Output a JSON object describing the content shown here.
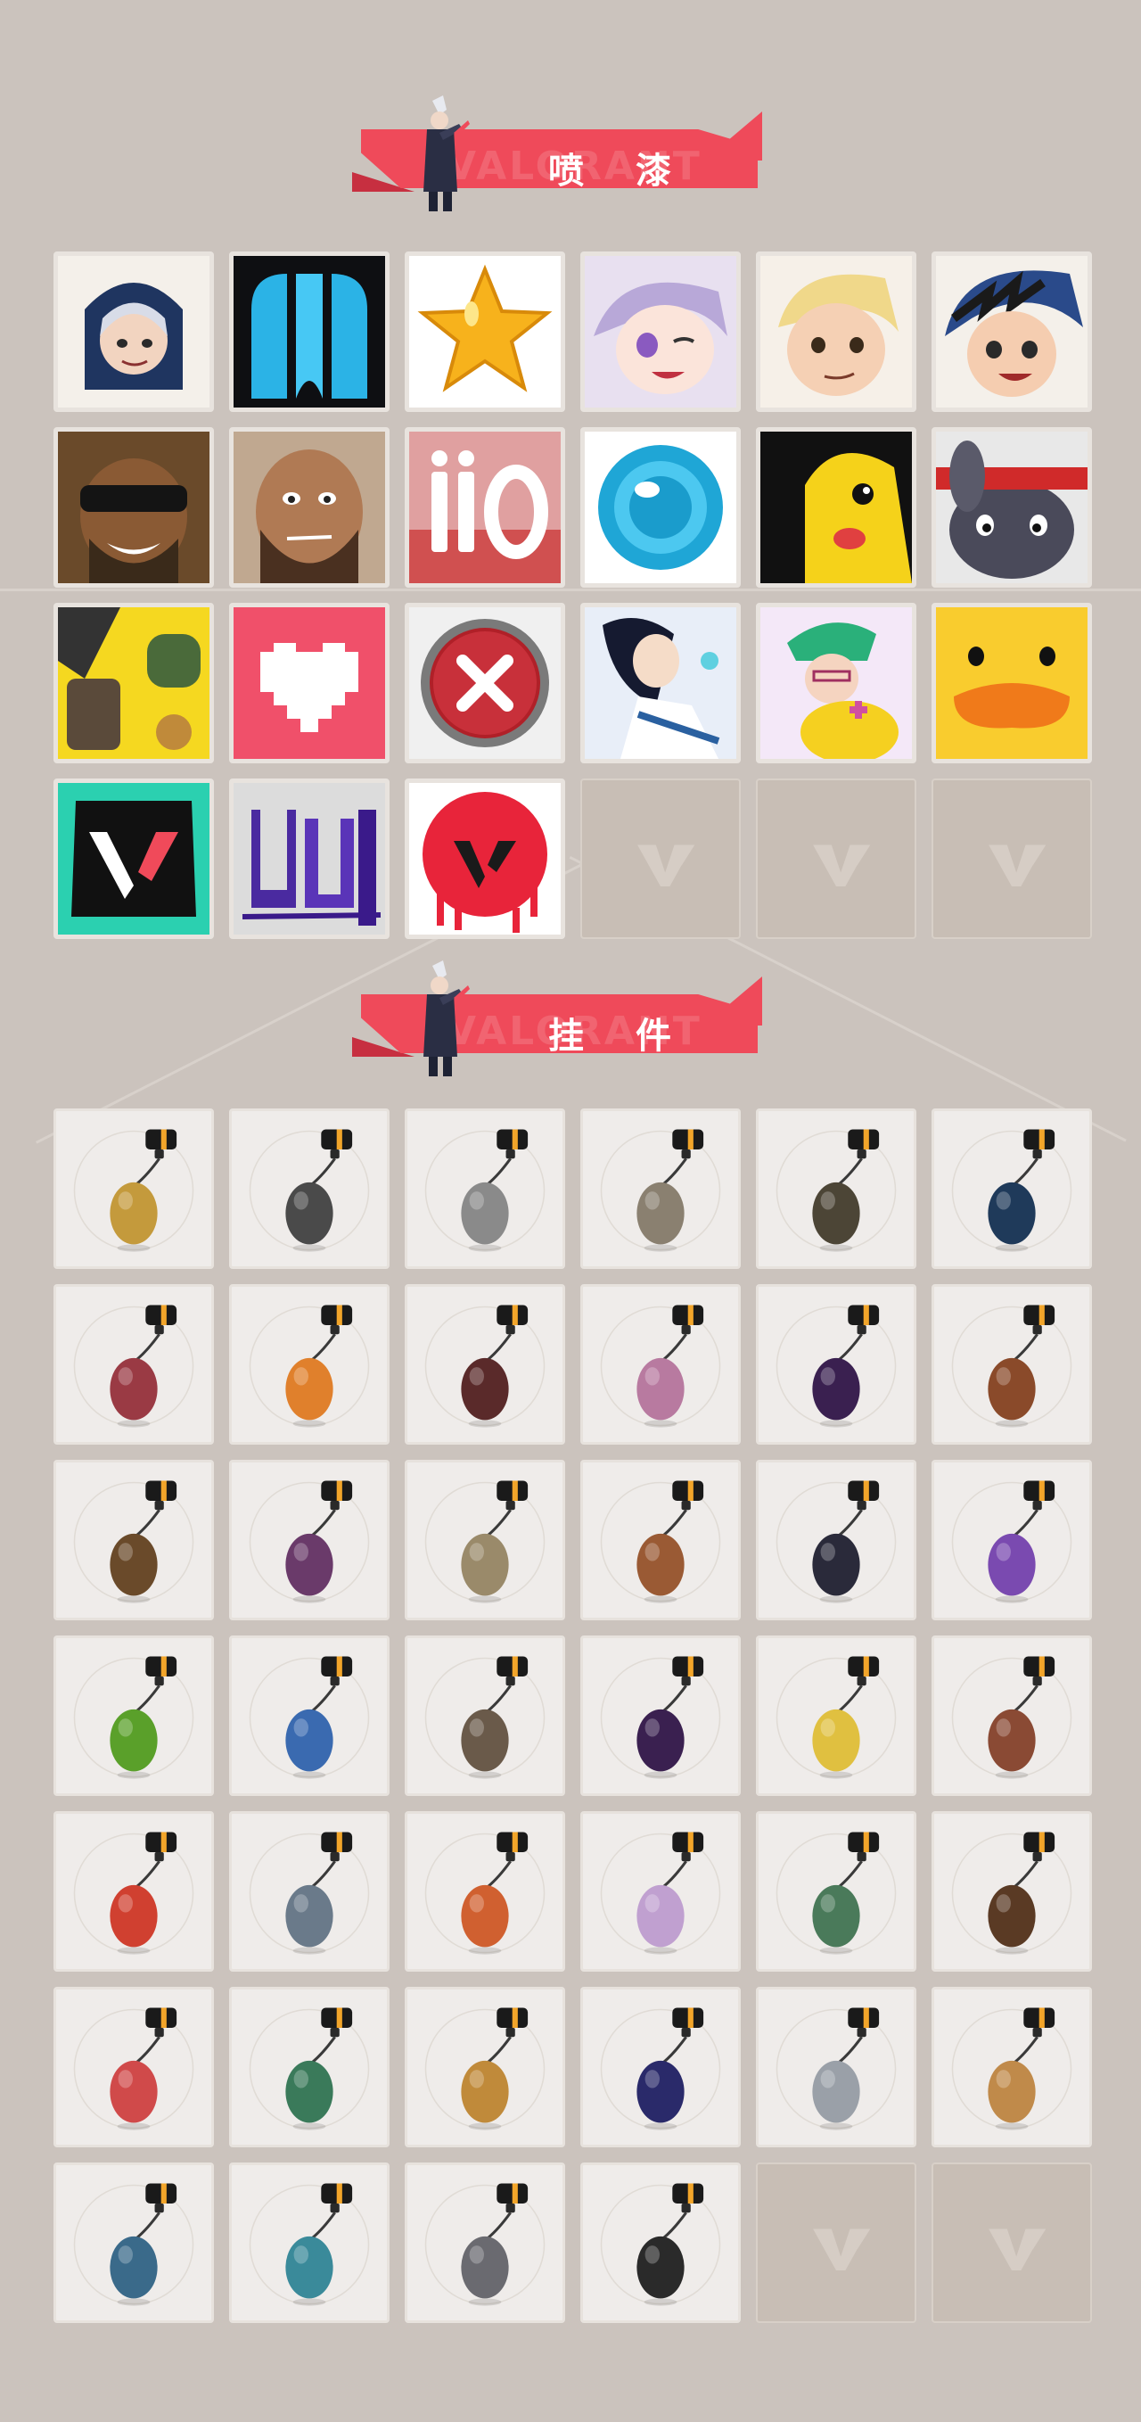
{
  "sections": [
    {
      "id": "sprays",
      "title": "喷 漆",
      "watermark": "VALORANT"
    },
    {
      "id": "buddies",
      "title": "挂 件",
      "watermark": "VALORANT"
    }
  ],
  "sprays": [
    {
      "icon": "hooded-girl-spray-icon"
    },
    {
      "icon": "blue-drip-logo-spray-icon"
    },
    {
      "icon": "star-spray-icon"
    },
    {
      "icon": "purple-hair-girl-spray-icon"
    },
    {
      "icon": "blonde-boy-spray-icon"
    },
    {
      "icon": "blue-hood-girl-spray-icon"
    },
    {
      "icon": "sunglasses-man-spray-icon"
    },
    {
      "icon": "bearded-man-spray-icon"
    },
    {
      "icon": "ii-o-text-spray-icon"
    },
    {
      "icon": "blue-lens-spray-icon"
    },
    {
      "icon": "yellow-creature-spray-icon"
    },
    {
      "icon": "gray-bunny-spray-icon"
    },
    {
      "icon": "fist-bump-spray-icon"
    },
    {
      "icon": "pixel-heart-spray-icon"
    },
    {
      "icon": "red-x-button-spray-icon"
    },
    {
      "icon": "dark-hair-agent-spray-icon"
    },
    {
      "icon": "green-hair-healer-spray-icon"
    },
    {
      "icon": "yellow-duck-spray-icon"
    },
    {
      "icon": "valorant-v-graffiti-spray-icon"
    },
    {
      "icon": "purple-graffiti-spray-icon"
    },
    {
      "icon": "red-v-drip-spray-icon"
    },
    {
      "icon": "empty-slot-icon",
      "empty": true
    },
    {
      "icon": "empty-slot-icon",
      "empty": true
    },
    {
      "icon": "empty-slot-icon",
      "empty": true
    }
  ],
  "buddies": [
    {
      "icon": "gold-bear-buddy-icon",
      "color": "#c49a3c"
    },
    {
      "icon": "robot-drone-buddy-icon",
      "color": "#4a4a4a"
    },
    {
      "icon": "toaster-buddy-icon",
      "color": "#8a8a8a"
    },
    {
      "icon": "cat-astronaut-buddy-icon",
      "color": "#8a8070"
    },
    {
      "icon": "dark-pouch-buddy-icon",
      "color": "#4c4536"
    },
    {
      "icon": "blue-canister-buddy-icon",
      "color": "#1f3a5a"
    },
    {
      "icon": "chainsaw-sword-buddy-icon",
      "color": "#9a3a44"
    },
    {
      "icon": "guitar-pick-buddy-icon",
      "color": "#e0802c"
    },
    {
      "icon": "braided-cord-buddy-icon",
      "color": "#5a2a2a"
    },
    {
      "icon": "cupcake-buddy-icon",
      "color": "#b87aa0"
    },
    {
      "icon": "ep9-medallion-buddy-icon",
      "color": "#3a2050"
    },
    {
      "icon": "gingerbread-bell-buddy-icon",
      "color": "#8a4a2a"
    },
    {
      "icon": "wooden-box-gadget-buddy-icon",
      "color": "#6a4a2a"
    },
    {
      "icon": "agent-figure-buddy-icon",
      "color": "#6a3a6a"
    },
    {
      "icon": "cowboy-robot-buddy-icon",
      "color": "#9a8a6a"
    },
    {
      "icon": "cardboard-box-buddy-icon",
      "color": "#9a5a34"
    },
    {
      "icon": "hat-creature-buddy-icon",
      "color": "#2a2a3a"
    },
    {
      "icon": "lava-lamp-buddy-icon",
      "color": "#7a4ab0"
    },
    {
      "icon": "green-pager-buddy-icon",
      "color": "#5aa02a"
    },
    {
      "icon": "blue-astronaut-buddy-icon",
      "color": "#3a6ab0"
    },
    {
      "icon": "orange-radio-buddy-icon",
      "color": "#6a5a4a"
    },
    {
      "icon": "ep9-medallion-buddy-icon",
      "color": "#3a2050"
    },
    {
      "icon": "banana-buddy-icon",
      "color": "#e0c040"
    },
    {
      "icon": "ice-cream-bar-buddy-icon",
      "color": "#8a4a34"
    },
    {
      "icon": "chili-skewer-buddy-icon",
      "color": "#d04030"
    },
    {
      "icon": "silver-agent-tag-buddy-icon",
      "color": "#6a7a8a"
    },
    {
      "icon": "hot-air-balloon-buddy-icon",
      "color": "#d06030"
    },
    {
      "icon": "pink-hair-chibi-buddy-icon",
      "color": "#c0a0d0"
    },
    {
      "icon": "green-robot-buddy-icon",
      "color": "#4a7a5a"
    },
    {
      "icon": "lute-buddy-icon",
      "color": "#5a3a24"
    },
    {
      "icon": "watermelon-buddy-icon",
      "color": "#d04a4a"
    },
    {
      "icon": "green-can-buddy-icon",
      "color": "#3a7a5a"
    },
    {
      "icon": "honey-pot-buddy-icon",
      "color": "#c08a3a"
    },
    {
      "icon": "ep9-medallion-buddy-icon",
      "color": "#2a2a6a"
    },
    {
      "icon": "silver-hook-buddy-icon",
      "color": "#9aa0a8"
    },
    {
      "icon": "fox-cat-buddy-icon",
      "color": "#c08a4a"
    },
    {
      "icon": "potion-bottle-buddy-icon",
      "color": "#3a6a8a"
    },
    {
      "icon": "ufo-buddy-icon",
      "color": "#3a8a9a"
    },
    {
      "icon": "gray-cat-head-buddy-icon",
      "color": "#6a6a70"
    },
    {
      "icon": "black-gold-medallion-buddy-icon",
      "color": "#2a2a2a"
    },
    {
      "icon": "empty-slot-icon",
      "empty": true
    },
    {
      "icon": "empty-slot-icon",
      "empty": true
    }
  ],
  "colors": {
    "accent": "#ef4a5a",
    "background": "#cbc3bd",
    "tile": "#efecea",
    "empty": "#c8beb5"
  }
}
